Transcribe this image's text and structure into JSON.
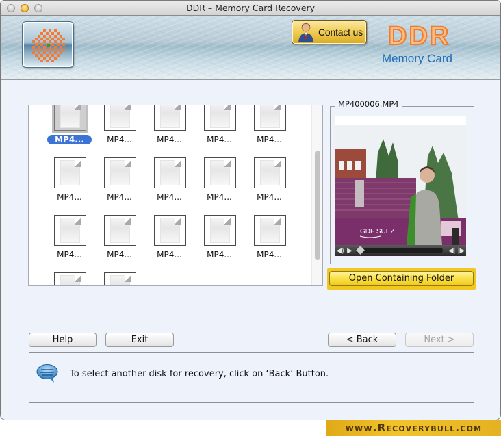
{
  "window": {
    "title": "DDR – Memory Card Recovery"
  },
  "header": {
    "contact_label": "Contact us",
    "brand_name": "DDR",
    "brand_subtitle": "Memory Card",
    "colors": {
      "brand_orange": "#f27a2a",
      "brand_blue": "#1f6fb6"
    }
  },
  "file_browser": {
    "selected_index": 0,
    "items": [
      {
        "label": "MP4...",
        "icon": "document-icon"
      },
      {
        "label": "MP4...",
        "icon": "document-icon"
      },
      {
        "label": "MP4...",
        "icon": "document-icon"
      },
      {
        "label": "MP4...",
        "icon": "document-icon"
      },
      {
        "label": "MP4...",
        "icon": "document-icon"
      },
      {
        "label": "MP4...",
        "icon": "document-icon"
      },
      {
        "label": "MP4...",
        "icon": "document-icon"
      },
      {
        "label": "MP4...",
        "icon": "document-icon"
      },
      {
        "label": "MP4...",
        "icon": "document-icon"
      },
      {
        "label": "MP4...",
        "icon": "document-icon"
      },
      {
        "label": "MP4...",
        "icon": "document-icon"
      },
      {
        "label": "MP4...",
        "icon": "document-icon"
      },
      {
        "label": "MP4...",
        "icon": "document-icon"
      },
      {
        "label": "MP4...",
        "icon": "document-icon"
      },
      {
        "label": "MP4...",
        "icon": "document-icon"
      },
      {
        "label": "",
        "icon": "document-icon"
      },
      {
        "label": "",
        "icon": "document-icon"
      }
    ],
    "selection_color": "#3c74d6"
  },
  "preview": {
    "file_name": "MP400006.MP4",
    "banner_text": "GDF SUEZ",
    "player": {
      "volume_icon": "speaker-icon",
      "play_icon": "play-icon",
      "progress_fraction": 0.0,
      "prev_icon": "step-back-icon",
      "next_icon": "step-forward-icon"
    },
    "open_folder_label": "Open Containing Folder"
  },
  "buttons": {
    "help": "Help",
    "exit": "Exit",
    "back": "< Back",
    "next": "Next >",
    "next_disabled": true
  },
  "message": {
    "icon": "speech-bubble-icon",
    "text": "To select another disk for recovery, click on ‘Back’ Button."
  },
  "watermark": "www.Recoverybull.com"
}
